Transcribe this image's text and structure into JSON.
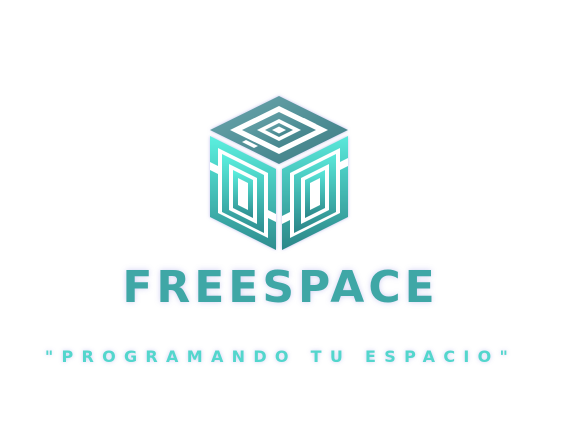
{
  "logo": {
    "icon": "cube-icon",
    "colors": {
      "top_light": "#5fa9ad",
      "top_dark": "#3d7f86",
      "face_light": "#55e6d8",
      "face_dark": "#2f8e90",
      "glow": "#8c8ce0"
    }
  },
  "brand": {
    "name": "FREESPACE",
    "color": "#3fa7a6"
  },
  "tagline": {
    "text": "\"PROGRAMANDO TU ESPACIO\"",
    "color": "#53d6cc"
  }
}
